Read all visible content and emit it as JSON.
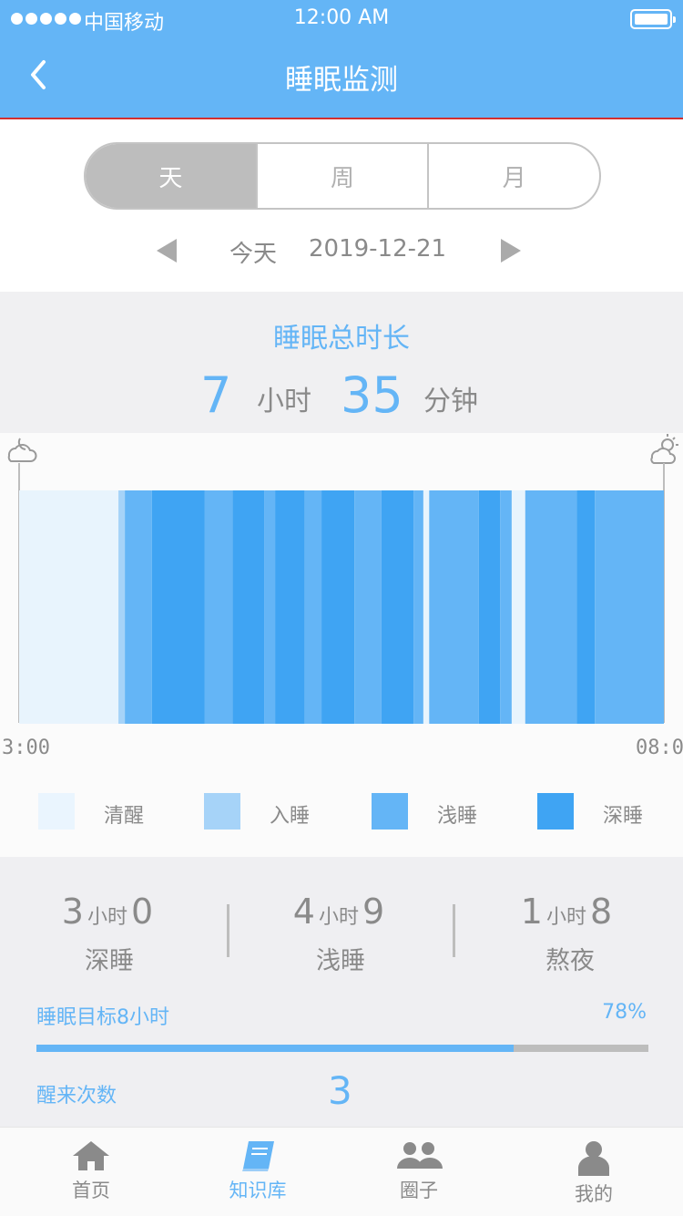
{
  "status_bar": {
    "carrier": "中国移动",
    "time": "12:00 AM"
  },
  "nav": {
    "title": "睡眠监测",
    "back_icon": "chevron-left-icon"
  },
  "period_tabs": [
    "天",
    "周",
    "月"
  ],
  "date_row": {
    "label": "今天",
    "date": "2019-12-21"
  },
  "summary": {
    "label": "睡眠总时长",
    "hours": "7",
    "hours_unit": "小时",
    "minutes": "35",
    "minutes_unit": "分钟"
  },
  "chart_data": {
    "type": "bar",
    "x_start_label": "3:00",
    "x_end_label": "08:00",
    "left_icon": "moon-cloud-icon",
    "right_icon": "sun-cloud-icon",
    "stage_colors": {
      "awake": "#e8f4fd",
      "falling_asleep": "#a6d3f8",
      "light": "#64b5f6",
      "deep": "#3fa4f3"
    },
    "segments": [
      {
        "stage": "awake",
        "start": 0.0,
        "end": 0.154
      },
      {
        "stage": "falling_asleep",
        "start": 0.154,
        "end": 0.164
      },
      {
        "stage": "light",
        "start": 0.164,
        "end": 0.206
      },
      {
        "stage": "deep",
        "start": 0.206,
        "end": 0.288
      },
      {
        "stage": "light",
        "start": 0.288,
        "end": 0.331
      },
      {
        "stage": "deep",
        "start": 0.331,
        "end": 0.38
      },
      {
        "stage": "light",
        "start": 0.38,
        "end": 0.397
      },
      {
        "stage": "deep",
        "start": 0.397,
        "end": 0.443
      },
      {
        "stage": "light",
        "start": 0.443,
        "end": 0.469
      },
      {
        "stage": "deep",
        "start": 0.469,
        "end": 0.52
      },
      {
        "stage": "light",
        "start": 0.52,
        "end": 0.562
      },
      {
        "stage": "deep",
        "start": 0.562,
        "end": 0.612
      },
      {
        "stage": "light",
        "start": 0.612,
        "end": 0.627
      },
      {
        "stage": "awake",
        "start": 0.627,
        "end": 0.636
      },
      {
        "stage": "light",
        "start": 0.636,
        "end": 0.713
      },
      {
        "stage": "deep",
        "start": 0.713,
        "end": 0.746
      },
      {
        "stage": "light",
        "start": 0.746,
        "end": 0.764
      },
      {
        "stage": "awake",
        "start": 0.764,
        "end": 0.785
      },
      {
        "stage": "light",
        "start": 0.785,
        "end": 0.865
      },
      {
        "stage": "deep",
        "start": 0.865,
        "end": 0.893
      },
      {
        "stage": "light",
        "start": 0.893,
        "end": 1.0
      }
    ]
  },
  "legend": [
    {
      "label": "清醒",
      "color": "#eaf5fe"
    },
    {
      "label": "入睡",
      "color": "#a6d3f8"
    },
    {
      "label": "浅睡",
      "color": "#64b5f6"
    },
    {
      "label": "深睡",
      "color": "#3fa4f3"
    }
  ],
  "stats": [
    {
      "a": "3",
      "unit": "小时",
      "b": "0",
      "label": "深睡"
    },
    {
      "a": "4",
      "unit": "小时",
      "b": "9",
      "label": "浅睡"
    },
    {
      "a": "1",
      "unit": "小时",
      "b": "8",
      "label": "熬夜"
    }
  ],
  "goal": {
    "label": "睡眠目标8小时",
    "percent_text": "78%",
    "progress": 0.78
  },
  "wake": {
    "label": "醒来次数",
    "value": "3"
  },
  "tabbar": [
    {
      "label": "首页",
      "icon": "home-icon"
    },
    {
      "label": "知识库",
      "icon": "book-icon",
      "active": true
    },
    {
      "label": "圈子",
      "icon": "group-icon"
    },
    {
      "label": "我的",
      "icon": "person-icon"
    }
  ],
  "colors": {
    "accent": "#64b5f6",
    "header": "#64b5f6",
    "header_border": "#d32f2f"
  }
}
